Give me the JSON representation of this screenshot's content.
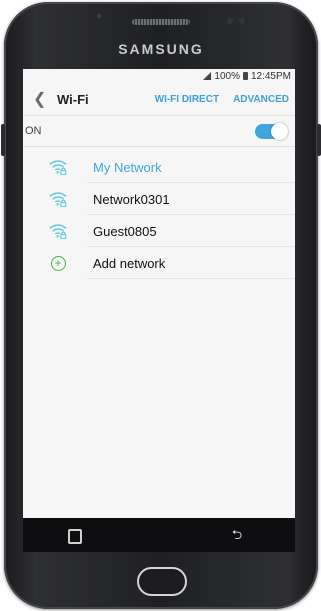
{
  "brand": "SAMSUNG",
  "status_bar": {
    "battery": "100%",
    "time": "12:45PM"
  },
  "header": {
    "back_icon": "back-arrow-icon",
    "title": "Wi-Fi",
    "actions": [
      "WI-FI DIRECT",
      "ADVANCED"
    ]
  },
  "wifi_toggle": {
    "label": "ON",
    "state": "on"
  },
  "networks": [
    {
      "name": "My Network",
      "status": "connected",
      "icon": "wifi-lock-icon"
    },
    {
      "name": "Network0301",
      "status": "available",
      "icon": "wifi-lock-icon"
    },
    {
      "name": "Guest0805",
      "status": "available",
      "icon": "wifi-lock-icon"
    }
  ],
  "add_network": {
    "label": "Add network",
    "icon": "plus-icon"
  },
  "colors": {
    "accent": "#3f9fd9",
    "connected": "#3fa7dd",
    "plus": "#4caf50",
    "screen_bg": "#f6f6f6"
  }
}
